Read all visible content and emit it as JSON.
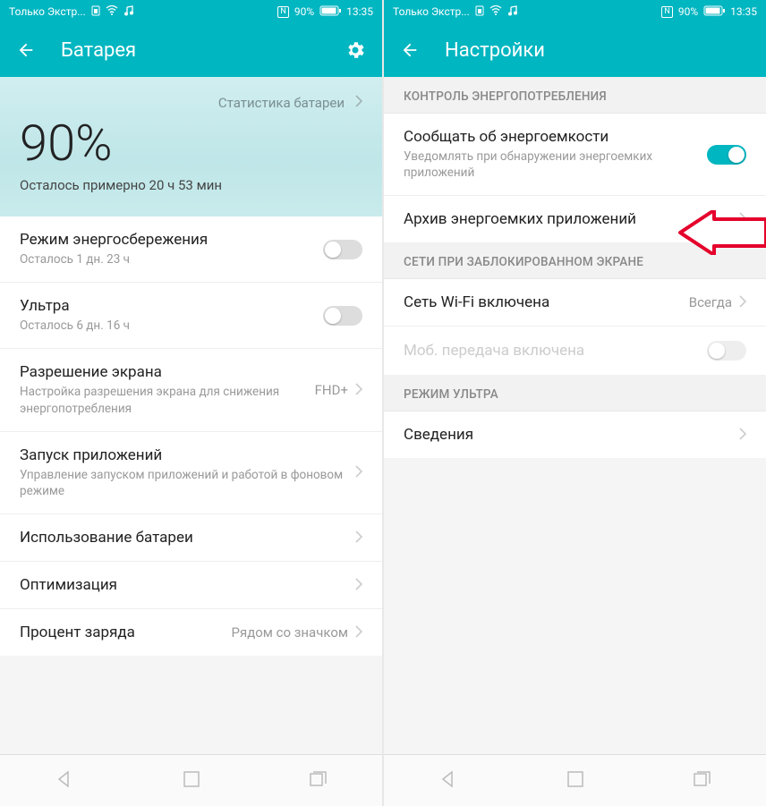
{
  "status": {
    "carrier": "Только Экстр...",
    "nfc": "N",
    "pct": "90%",
    "time": "13:35"
  },
  "left": {
    "title": "Батарея",
    "stats_link": "Статистика батареи",
    "battery_pct": "90%",
    "remaining": "Осталось примерно 20 ч 53 мин",
    "rows": {
      "powersave_t": "Режим энергосбережения",
      "powersave_s": "Осталось 1 дн. 23 ч",
      "ultra_t": "Ультра",
      "ultra_s": "Осталось 6 дн. 16 ч",
      "res_t": "Разрешение экрана",
      "res_s": "Настройка разрешения экрана для снижения энергопотребления",
      "res_v": "FHD+",
      "launch_t": "Запуск приложений",
      "launch_s": "Управление запуском приложений и работой в фоновом режиме",
      "usage_t": "Использование батареи",
      "opt_t": "Оптимизация",
      "pct_t": "Процент заряда",
      "pct_v": "Рядом со значком"
    }
  },
  "right": {
    "title": "Настройки",
    "sec1": "Контроль энергопотребления",
    "notify_t": "Сообщать об энергоемкости",
    "notify_s": "Уведомлять при обнаружении энергоемких приложений",
    "archive_t": "Архив энергоемких приложений",
    "sec2": "Сети при заблокированном экране",
    "wifi_t": "Сеть Wi-Fi включена",
    "wifi_v": "Всегда",
    "mobile_t": "Моб. передача включена",
    "sec3": "Режим ультра",
    "info_t": "Сведения"
  }
}
